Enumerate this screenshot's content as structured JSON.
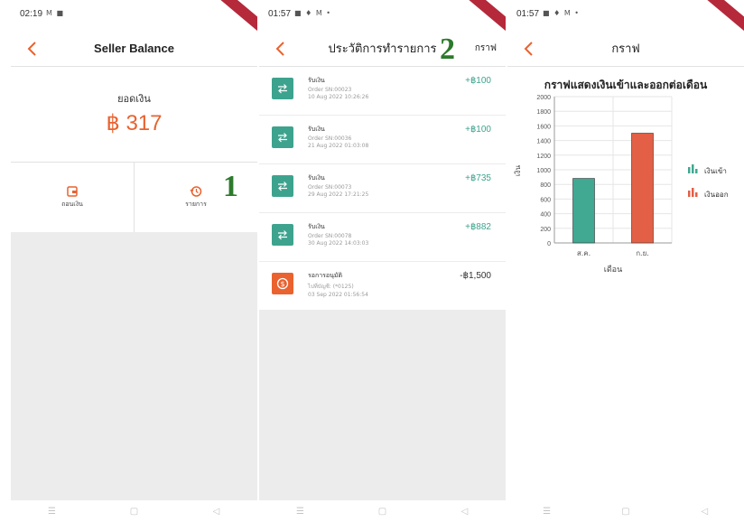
{
  "colors": {
    "accent": "#e9622f",
    "teal": "#3da38e",
    "bar_in": "#41a892",
    "bar_out": "#e35f46"
  },
  "panel1": {
    "status": {
      "time": "02:19",
      "icons": "M ■"
    },
    "title": "Seller Balance",
    "balance_label": "ยอดเงิน",
    "balance_amount": "฿ 317",
    "actions": [
      {
        "label": "ถอนเงิน",
        "icon": "wallet-icon"
      },
      {
        "label": "รายการ",
        "icon": "history-icon"
      }
    ],
    "step": "1"
  },
  "panel2": {
    "status": {
      "time": "01:57",
      "icons": "■ ♦ M •"
    },
    "title": "ประวัติการทำรายการ",
    "graph_link": "กราฟ",
    "step": "2",
    "transactions": [
      {
        "title": "รับเงิน",
        "line1": "Order SN:00023",
        "line2": "10 Aug 2022 10:26:26",
        "amount": "+฿100",
        "type": "in"
      },
      {
        "title": "รับเงิน",
        "line1": "Order SN:00036",
        "line2": "21 Aug 2022 01:03:08",
        "amount": "+฿100",
        "type": "in"
      },
      {
        "title": "รับเงิน",
        "line1": "Order SN:00073",
        "line2": "29 Aug 2022 17:21:25",
        "amount": "+฿735",
        "type": "in"
      },
      {
        "title": "รับเงิน",
        "line1": "Order SN:00078",
        "line2": "30 Aug 2022 14:03:03",
        "amount": "+฿882",
        "type": "in"
      },
      {
        "title": "รอการอนุมัติ",
        "line1": "ไปที่บัญชี: (*0125)",
        "line2": "03 Sep 2022 01:56:54",
        "amount": "-฿1,500",
        "type": "pending"
      }
    ]
  },
  "panel3": {
    "status": {
      "time": "01:57",
      "icons": "■ ♦ M •"
    },
    "title": "กราฟ"
  },
  "chart_data": {
    "type": "bar",
    "title": "กราฟแสดงเงินเข้าและออกต่อเดือน",
    "xlabel": "เดือน",
    "ylabel": "เงิน",
    "categories": [
      "ส.ค.",
      "ก.ย."
    ],
    "ylim": [
      0,
      2000
    ],
    "yticks": [
      0,
      200,
      400,
      600,
      800,
      1000,
      1200,
      1400,
      1600,
      1800,
      2000
    ],
    "grid": true,
    "legend_position": "right",
    "series": [
      {
        "name": "เงินเข้า",
        "values": [
          882,
          0
        ],
        "color": "#41a892"
      },
      {
        "name": "เงินออก",
        "values": [
          0,
          1500
        ],
        "color": "#e35f46"
      }
    ]
  }
}
